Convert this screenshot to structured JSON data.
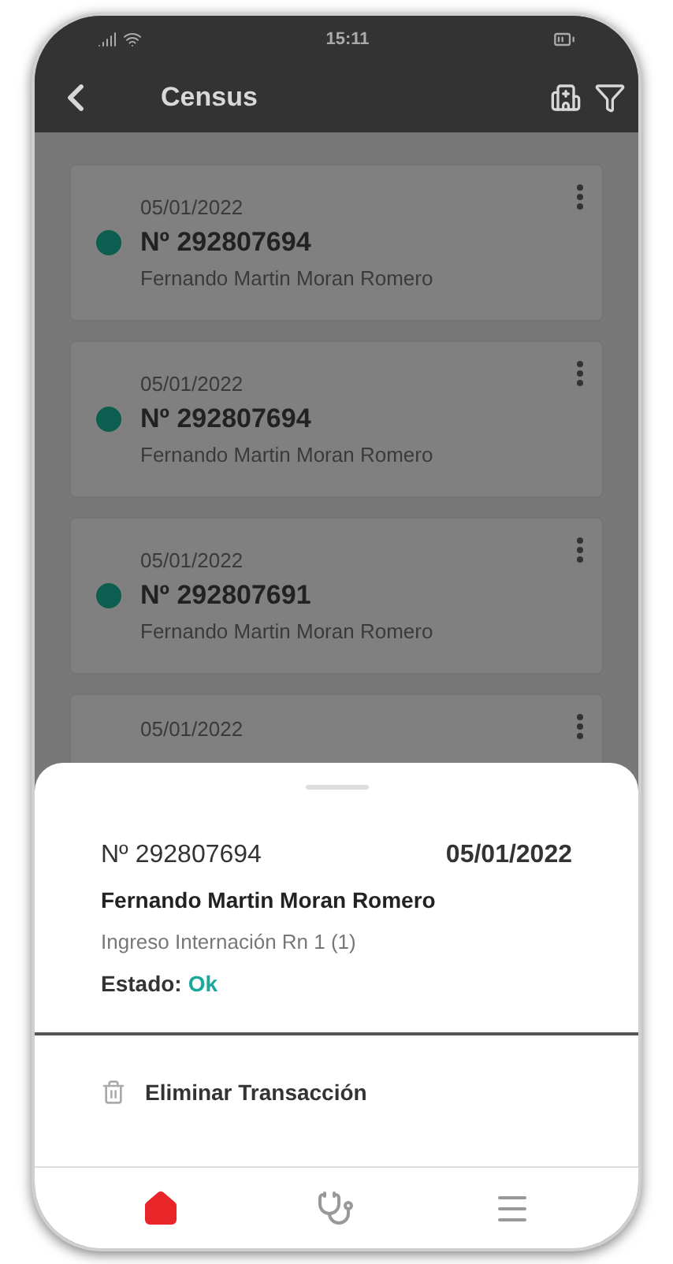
{
  "status_bar": {
    "time": "15:11"
  },
  "header": {
    "title": "Census"
  },
  "records": [
    {
      "date": "05/01/2022",
      "number": "Nº 292807694",
      "name": "Fernando Martin Moran Romero",
      "color": "#0b5e50"
    },
    {
      "date": "05/01/2022",
      "number": "Nº 292807694",
      "name": "Fernando Martin Moran Romero",
      "color": "#0b5e50"
    },
    {
      "date": "05/01/2022",
      "number": "Nº 292807691",
      "name": "Fernando Martin Moran Romero",
      "color": "#0b5e50"
    },
    {
      "date": "05/01/2022"
    }
  ],
  "sheet": {
    "number": "Nº 292807694",
    "date": "05/01/2022",
    "name": "Fernando Martin Moran Romero",
    "detail": "Ingreso Internación Rn 1 (1)",
    "status_label": "Estado:",
    "status_value": "Ok",
    "action": "Eliminar Transacción"
  },
  "nav": [
    {
      "kind": "home",
      "selected": true
    },
    {
      "kind": "stethoscope",
      "selected": false
    },
    {
      "kind": "menu",
      "selected": false
    }
  ]
}
